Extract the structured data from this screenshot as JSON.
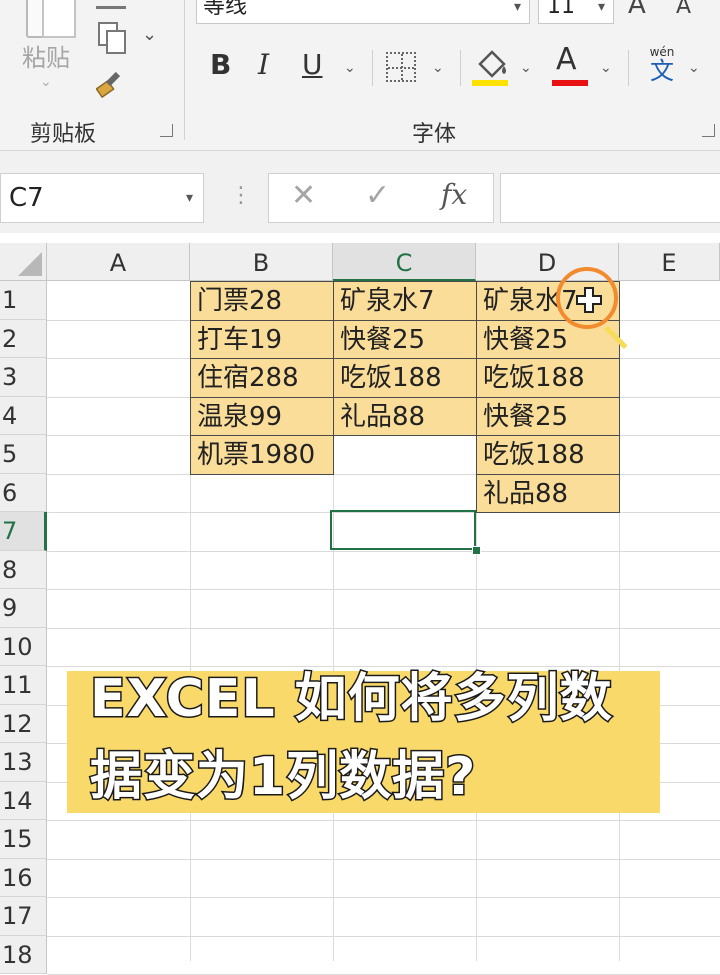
{
  "ribbon": {
    "paste_label": "粘贴",
    "clipboard_group": "剪贴板",
    "font_group": "字体",
    "font_name": "等线",
    "font_size": "11",
    "grow_font": "A",
    "shrink_font": "A",
    "bold": "B",
    "italic": "I",
    "underline": "U",
    "font_color_glyph": "A",
    "phonetic_pinyin": "wén",
    "phonetic_char": "文",
    "fill_color": "#ffe100",
    "font_color": "#e81010"
  },
  "formula_bar": {
    "name_box": "C7",
    "cancel_glyph": "✕",
    "enter_glyph": "✓",
    "fx_label": "fx",
    "value": ""
  },
  "sheet": {
    "columns": [
      "A",
      "B",
      "C",
      "D",
      "E"
    ],
    "selected_column": "C",
    "rows": [
      "1",
      "2",
      "3",
      "4",
      "5",
      "6",
      "7",
      "8",
      "9",
      "10",
      "11",
      "12",
      "13",
      "14",
      "15",
      "16",
      "17",
      "18"
    ],
    "selected_row": "7",
    "active_cell": "C7",
    "cells": {
      "B": [
        "门票28",
        "打车19",
        "住宿288",
        "温泉99",
        "机票1980"
      ],
      "C": [
        "矿泉水7",
        "快餐25",
        "吃饭188",
        "礼品88"
      ],
      "D": [
        "矿泉水7",
        "快餐25",
        "吃饭188",
        "快餐25",
        "吃饭188",
        "礼品88"
      ]
    },
    "fill_color": "#fbdd9a"
  },
  "caption": {
    "line1": "EXCEL 如何将多列数",
    "line2": "据变为1列数据?",
    "banner_color": "#f8d96a"
  }
}
